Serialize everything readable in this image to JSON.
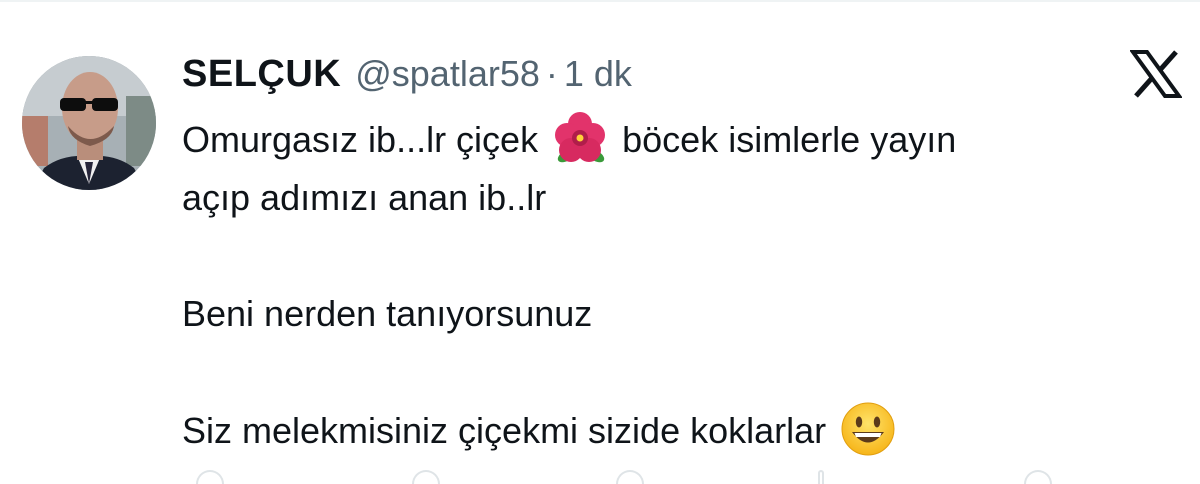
{
  "tweet": {
    "display_name": "SELÇUK",
    "handle": "@spatlar58",
    "separator": "·",
    "timestamp": "1 dk",
    "lines": {
      "l1a": "Omurgasız ib...lr çiçek",
      "l1b": "böcek isimlerle yayın",
      "l2": "açıp adımızı anan ib..lr",
      "l3": "Beni nerden tanıyorsunuz",
      "l4": "Siz melekmisiniz çiçekmi sizide koklarlar"
    },
    "emojis": [
      "hibiscus-emoji",
      "smiley-emoji"
    ]
  },
  "platform": {
    "logo": "x-logo-icon"
  },
  "colors": {
    "text": "#0f1419",
    "secondary": "#536471",
    "divider": "#eff3f4"
  }
}
